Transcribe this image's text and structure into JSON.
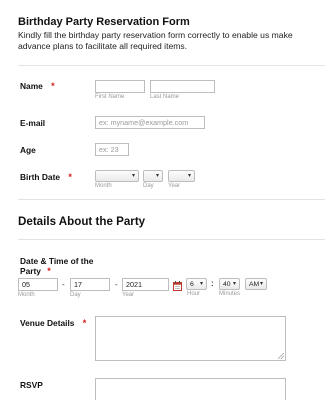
{
  "form": {
    "title": "Birthday Party Reservation Form",
    "description": "Kindly fill the birthday party reservation form correctly to enable us make advance plans to facilitate all required items."
  },
  "name": {
    "label": "Name",
    "required_mark": "*",
    "first_caption": "First Name",
    "last_caption": "Last Name",
    "first_value": "",
    "last_value": ""
  },
  "email": {
    "label": "E-mail",
    "placeholder": "ex: myname@example.com"
  },
  "age": {
    "label": "Age",
    "placeholder": "ex: 23"
  },
  "birth_date": {
    "label": "Birth Date",
    "required_mark": "*",
    "month_caption": "Month",
    "day_caption": "Day",
    "year_caption": "Year",
    "month_value": "",
    "day_value": "",
    "year_value": "",
    "arrow": "▾"
  },
  "section": {
    "title": "Details About the Party"
  },
  "party_datetime": {
    "label_line1": "Date & Time of the",
    "label_line2": "Party",
    "required_mark": "*",
    "month_value": "05",
    "day_value": "17",
    "year_value": "2021",
    "month_caption": "Month",
    "day_caption": "Day",
    "year_caption": "Year",
    "separator": "-",
    "hour_value": "6",
    "minute_value": "40",
    "ampm_value": "AM",
    "time_separator": ":",
    "hour_caption": "Hour",
    "minutes_caption": "Minutes",
    "arrow": "▾"
  },
  "venue": {
    "label": "Venue Details",
    "required_mark": "*"
  },
  "rsvp": {
    "label": "RSVP"
  },
  "colors": {
    "required": "#d51a1a",
    "border": "#bdbdbd",
    "caption": "#9a9a9a",
    "calendar_icon": "#c0392b"
  },
  "icons": {
    "calendar": "calendar-icon"
  }
}
